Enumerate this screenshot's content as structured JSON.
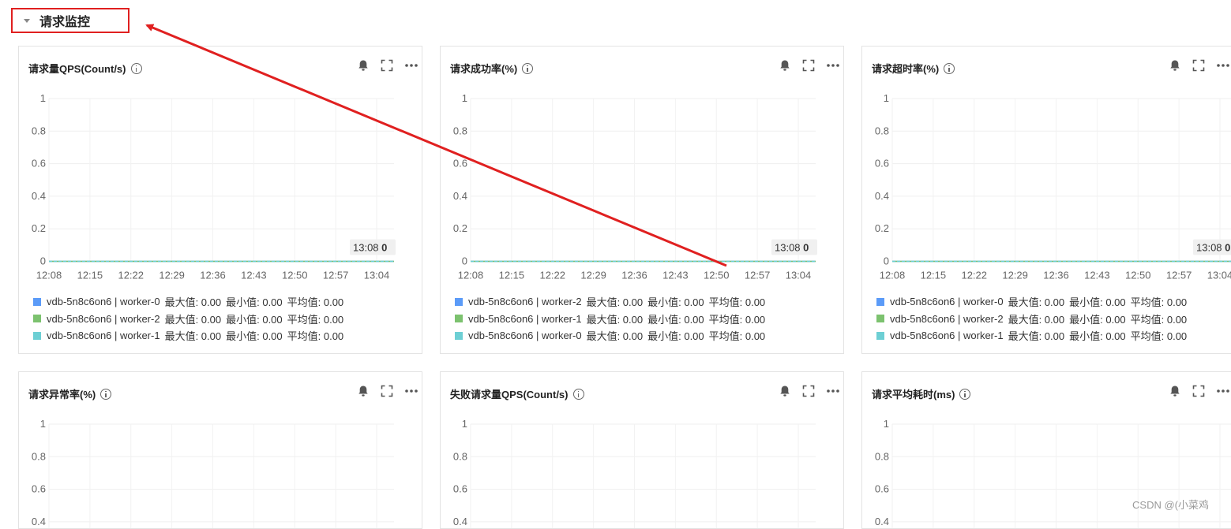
{
  "section": {
    "title": "请求监控"
  },
  "tooltip_time": "13:08",
  "tooltip_value": "0",
  "legend_stat_labels": {
    "max": "最大值:",
    "min": "最小值:",
    "avg": "平均值:"
  },
  "colors": {
    "series_blue": "#5b9bf8",
    "series_green": "#7cc26f",
    "series_teal": "#6dcfd4",
    "annotation": "#e02020"
  },
  "watermark": "CSDN @(小菜鸡",
  "panels": [
    {
      "title": "请求量QPS(Count/s)",
      "chart_data": {
        "type": "line",
        "title": "请求量QPS(Count/s)",
        "x": [
          "12:08",
          "12:15",
          "12:22",
          "12:29",
          "12:36",
          "12:43",
          "12:50",
          "12:57",
          "13:04"
        ],
        "y_ticks": [
          "1",
          "0.8",
          "0.6",
          "0.4",
          "0.2",
          "0"
        ],
        "ylim": [
          0,
          1
        ],
        "series": [
          {
            "name": "vdb-5n8c6on6 | worker-0",
            "color": "#5b9bf8",
            "values": [
              0,
              0,
              0,
              0,
              0,
              0,
              0,
              0,
              0
            ],
            "max": "0.00",
            "min": "0.00",
            "avg": "0.00"
          },
          {
            "name": "vdb-5n8c6on6 | worker-2",
            "color": "#7cc26f",
            "values": [
              0,
              0,
              0,
              0,
              0,
              0,
              0,
              0,
              0
            ],
            "max": "0.00",
            "min": "0.00",
            "avg": "0.00"
          },
          {
            "name": "vdb-5n8c6on6 | worker-1",
            "color": "#6dcfd4",
            "values": [
              0,
              0,
              0,
              0,
              0,
              0,
              0,
              0,
              0
            ],
            "max": "0.00",
            "min": "0.00",
            "avg": "0.00"
          }
        ]
      }
    },
    {
      "title": "请求成功率(%)",
      "chart_data": {
        "type": "line",
        "title": "请求成功率(%)",
        "x": [
          "12:08",
          "12:15",
          "12:22",
          "12:29",
          "12:36",
          "12:43",
          "12:50",
          "12:57",
          "13:04"
        ],
        "y_ticks": [
          "1",
          "0.8",
          "0.6",
          "0.4",
          "0.2",
          "0"
        ],
        "ylim": [
          0,
          1
        ],
        "series": [
          {
            "name": "vdb-5n8c6on6 | worker-2",
            "color": "#5b9bf8",
            "values": [
              0,
              0,
              0,
              0,
              0,
              0,
              0,
              0,
              0
            ],
            "max": "0.00",
            "min": "0.00",
            "avg": "0.00"
          },
          {
            "name": "vdb-5n8c6on6 | worker-1",
            "color": "#7cc26f",
            "values": [
              0,
              0,
              0,
              0,
              0,
              0,
              0,
              0,
              0
            ],
            "max": "0.00",
            "min": "0.00",
            "avg": "0.00"
          },
          {
            "name": "vdb-5n8c6on6 | worker-0",
            "color": "#6dcfd4",
            "values": [
              0,
              0,
              0,
              0,
              0,
              0,
              0,
              0,
              0
            ],
            "max": "0.00",
            "min": "0.00",
            "avg": "0.00"
          }
        ]
      }
    },
    {
      "title": "请求超时率(%)",
      "chart_data": {
        "type": "line",
        "title": "请求超时率(%)",
        "x": [
          "12:08",
          "12:15",
          "12:22",
          "12:29",
          "12:36",
          "12:43",
          "12:50",
          "12:57",
          "13:04"
        ],
        "y_ticks": [
          "1",
          "0.8",
          "0.6",
          "0.4",
          "0.2",
          "0"
        ],
        "ylim": [
          0,
          1
        ],
        "series": [
          {
            "name": "vdb-5n8c6on6 | worker-0",
            "color": "#5b9bf8",
            "values": [
              0,
              0,
              0,
              0,
              0,
              0,
              0,
              0,
              0
            ],
            "max": "0.00",
            "min": "0.00",
            "avg": "0.00"
          },
          {
            "name": "vdb-5n8c6on6 | worker-2",
            "color": "#7cc26f",
            "values": [
              0,
              0,
              0,
              0,
              0,
              0,
              0,
              0,
              0
            ],
            "max": "0.00",
            "min": "0.00",
            "avg": "0.00"
          },
          {
            "name": "vdb-5n8c6on6 | worker-1",
            "color": "#6dcfd4",
            "values": [
              0,
              0,
              0,
              0,
              0,
              0,
              0,
              0,
              0
            ],
            "max": "0.00",
            "min": "0.00",
            "avg": "0.00"
          }
        ]
      }
    },
    {
      "title": "请求异常率(%)",
      "chart_data": {
        "type": "line",
        "title": "请求异常率(%)",
        "y_ticks": [
          "1",
          "0.8",
          "0.6",
          "0.4"
        ],
        "ylim": [
          0,
          1
        ],
        "series": []
      }
    },
    {
      "title": "失败请求量QPS(Count/s)",
      "chart_data": {
        "type": "line",
        "title": "失败请求量QPS(Count/s)",
        "y_ticks": [
          "1",
          "0.8",
          "0.6",
          "0.4"
        ],
        "ylim": [
          0,
          1
        ],
        "series": []
      }
    },
    {
      "title": "请求平均耗时(ms)",
      "chart_data": {
        "type": "line",
        "title": "请求平均耗时(ms)",
        "y_ticks": [
          "1",
          "0.8",
          "0.6",
          "0.4"
        ],
        "ylim": [
          0,
          1
        ],
        "series": []
      }
    }
  ]
}
